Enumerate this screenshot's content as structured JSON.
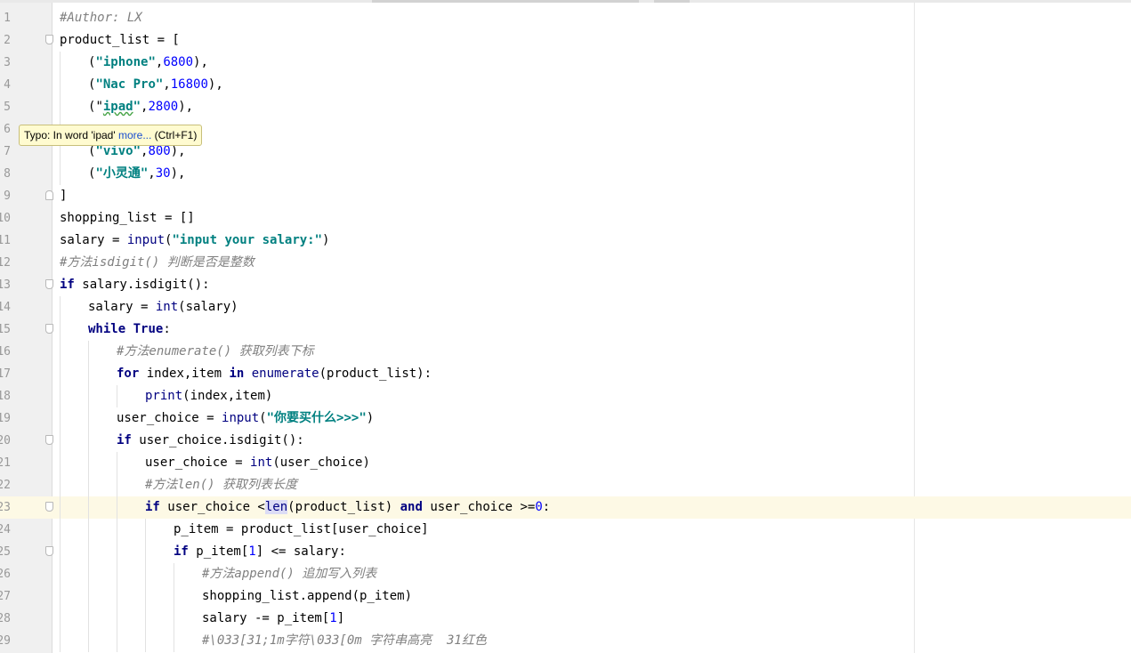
{
  "editor": {
    "lines": [
      {
        "n": "1",
        "fold": "",
        "indent": 0,
        "tokens": [
          {
            "t": "#Author: LX",
            "c": "cmt"
          }
        ]
      },
      {
        "n": "2",
        "fold": "down",
        "indent": 0,
        "tokens": [
          {
            "t": "product_list = ["
          }
        ]
      },
      {
        "n": "3",
        "fold": "",
        "indent": 1,
        "tokens": [
          {
            "t": "("
          },
          {
            "t": "\"iphone\"",
            "c": "str"
          },
          {
            "t": ","
          },
          {
            "t": "6800",
            "c": "num"
          },
          {
            "t": "),"
          }
        ]
      },
      {
        "n": "4",
        "fold": "",
        "indent": 1,
        "tokens": [
          {
            "t": "("
          },
          {
            "t": "\"Nac Pro\"",
            "c": "str"
          },
          {
            "t": ","
          },
          {
            "t": "16800",
            "c": "num"
          },
          {
            "t": "),"
          }
        ]
      },
      {
        "n": "5",
        "fold": "",
        "indent": 1,
        "tokens": [
          {
            "t": "("
          },
          {
            "t": "\""
          },
          {
            "t": "ipad",
            "c": "str typo"
          },
          {
            "t": "\"",
            "c": "str"
          },
          {
            "t": ","
          },
          {
            "t": "2800",
            "c": "num"
          },
          {
            "t": "),"
          }
        ]
      },
      {
        "n": "6",
        "fold": "",
        "indent": 1,
        "tokens": []
      },
      {
        "n": "7",
        "fold": "",
        "indent": 1,
        "tokens": [
          {
            "t": "("
          },
          {
            "t": "\"vivo\"",
            "c": "str"
          },
          {
            "t": ","
          },
          {
            "t": "800",
            "c": "num"
          },
          {
            "t": "),"
          }
        ]
      },
      {
        "n": "8",
        "fold": "",
        "indent": 1,
        "tokens": [
          {
            "t": "("
          },
          {
            "t": "\"小灵通\"",
            "c": "str"
          },
          {
            "t": ","
          },
          {
            "t": "30",
            "c": "num"
          },
          {
            "t": "),"
          }
        ]
      },
      {
        "n": "9",
        "fold": "up",
        "indent": 0,
        "tokens": [
          {
            "t": "]"
          }
        ]
      },
      {
        "n": "10",
        "fold": "",
        "indent": 0,
        "tokens": [
          {
            "t": "shopping_list = []"
          }
        ]
      },
      {
        "n": "11",
        "fold": "",
        "indent": 0,
        "tokens": [
          {
            "t": "salary = "
          },
          {
            "t": "input",
            "c": "bi"
          },
          {
            "t": "("
          },
          {
            "t": "\"input your salary:\"",
            "c": "str"
          },
          {
            "t": ")"
          }
        ]
      },
      {
        "n": "12",
        "fold": "",
        "indent": 0,
        "tokens": [
          {
            "t": "#方法isdigit() 判断是否是整数",
            "c": "cmt"
          }
        ]
      },
      {
        "n": "13",
        "fold": "down",
        "indent": 0,
        "tokens": [
          {
            "t": "if",
            "c": "kw"
          },
          {
            "t": " salary.isdigit():"
          }
        ]
      },
      {
        "n": "14",
        "fold": "",
        "indent": 1,
        "tokens": [
          {
            "t": "salary = "
          },
          {
            "t": "int",
            "c": "bi"
          },
          {
            "t": "(salary)"
          }
        ]
      },
      {
        "n": "15",
        "fold": "down",
        "indent": 1,
        "tokens": [
          {
            "t": "while",
            "c": "kw"
          },
          {
            "t": " "
          },
          {
            "t": "True",
            "c": "kw"
          },
          {
            "t": ":"
          }
        ]
      },
      {
        "n": "16",
        "fold": "",
        "indent": 2,
        "tokens": [
          {
            "t": "#方法enumerate() 获取列表下标",
            "c": "cmt"
          }
        ]
      },
      {
        "n": "17",
        "fold": "",
        "indent": 2,
        "tokens": [
          {
            "t": "for",
            "c": "kw"
          },
          {
            "t": " index,item "
          },
          {
            "t": "in",
            "c": "kw"
          },
          {
            "t": " "
          },
          {
            "t": "enumerate",
            "c": "bi"
          },
          {
            "t": "(product_list):"
          }
        ]
      },
      {
        "n": "18",
        "fold": "",
        "indent": 3,
        "tokens": [
          {
            "t": "print",
            "c": "bi"
          },
          {
            "t": "(index,item)"
          }
        ]
      },
      {
        "n": "19",
        "fold": "",
        "indent": 2,
        "tokens": [
          {
            "t": "user_choice = "
          },
          {
            "t": "input",
            "c": "bi"
          },
          {
            "t": "("
          },
          {
            "t": "\"你要买什么>>>\"",
            "c": "str"
          },
          {
            "t": ")"
          }
        ]
      },
      {
        "n": "20",
        "fold": "down",
        "indent": 2,
        "tokens": [
          {
            "t": "if",
            "c": "kw"
          },
          {
            "t": " user_choice.isdigit():"
          }
        ]
      },
      {
        "n": "21",
        "fold": "",
        "indent": 3,
        "tokens": [
          {
            "t": "user_choice = "
          },
          {
            "t": "int",
            "c": "bi"
          },
          {
            "t": "(user_choice)"
          }
        ]
      },
      {
        "n": "22",
        "fold": "",
        "indent": 3,
        "tokens": [
          {
            "t": "#方法len() 获取列表长度",
            "c": "cmt"
          }
        ]
      },
      {
        "n": "23",
        "fold": "down",
        "indent": 3,
        "current": true,
        "tokens": [
          {
            "t": "if",
            "c": "kw"
          },
          {
            "t": " user_choice <"
          },
          {
            "t": "len",
            "c": "bi hl"
          },
          {
            "t": "(product_list) "
          },
          {
            "t": "and",
            "c": "kw"
          },
          {
            "t": " user_choice >="
          },
          {
            "t": "0",
            "c": "num"
          },
          {
            "t": ":"
          }
        ]
      },
      {
        "n": "24",
        "fold": "",
        "indent": 4,
        "tokens": [
          {
            "t": "p_item = product_list[user_choice]"
          }
        ]
      },
      {
        "n": "25",
        "fold": "down",
        "indent": 4,
        "tokens": [
          {
            "t": "if",
            "c": "kw"
          },
          {
            "t": " p_item["
          },
          {
            "t": "1",
            "c": "num"
          },
          {
            "t": "] <= salary:"
          }
        ]
      },
      {
        "n": "26",
        "fold": "",
        "indent": 5,
        "tokens": [
          {
            "t": "#方法append() 追加写入列表",
            "c": "cmt"
          }
        ]
      },
      {
        "n": "27",
        "fold": "",
        "indent": 5,
        "tokens": [
          {
            "t": "shopping_list.append(p_item)"
          }
        ]
      },
      {
        "n": "28",
        "fold": "",
        "indent": 5,
        "tokens": [
          {
            "t": "salary -= p_item["
          },
          {
            "t": "1",
            "c": "num"
          },
          {
            "t": "]"
          }
        ]
      },
      {
        "n": "29",
        "fold": "",
        "indent": 5,
        "tokens": [
          {
            "t": "#\\033[31;1m字符\\033[0m 字符串高亮  31红色",
            "c": "cmt"
          }
        ]
      }
    ]
  },
  "tooltip": {
    "prefix": "Typo: In word 'ipad' ",
    "link": "more...",
    "shortcut": " (Ctrl+F1)"
  }
}
